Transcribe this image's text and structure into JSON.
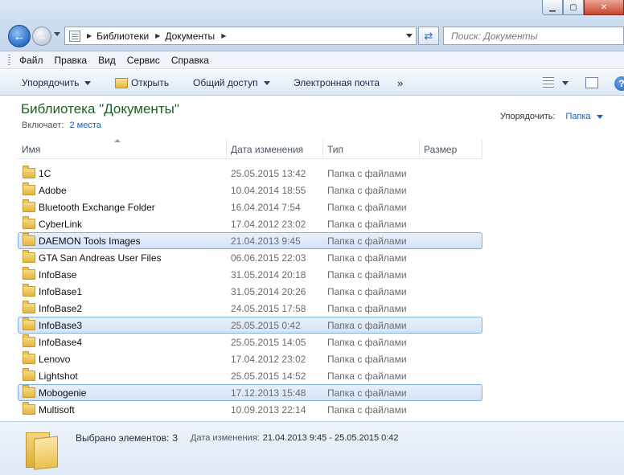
{
  "window": {
    "minimize_icon": "minimize-icon",
    "maximize_icon": "maximize-icon",
    "close_icon": "close-icon"
  },
  "address_bar": {
    "breadcrumbs": [
      "Библиотеки",
      "Документы"
    ],
    "search_placeholder": "Поиск: Документы"
  },
  "menu": [
    "Файл",
    "Правка",
    "Вид",
    "Сервис",
    "Справка"
  ],
  "toolbar": {
    "organize": "Упорядочить",
    "open": "Открыть",
    "share": "Общий доступ",
    "email": "Электронная почта",
    "more": "»",
    "help": "?"
  },
  "library": {
    "title": "Библиотека \"Документы\"",
    "includes_label": "Включает:",
    "includes_link": "2 места",
    "arrange_label": "Упорядочить:",
    "arrange_value": "Папка"
  },
  "columns": [
    "Имя",
    "Дата изменения",
    "Тип",
    "Размер"
  ],
  "files": [
    {
      "name": "1C",
      "date": "25.05.2015 13:42",
      "type": "Папка с файлами",
      "selected": false
    },
    {
      "name": "Adobe",
      "date": "10.04.2014 18:55",
      "type": "Папка с файлами",
      "selected": false
    },
    {
      "name": "Bluetooth Exchange Folder",
      "date": "16.04.2014 7:54",
      "type": "Папка с файлами",
      "selected": false
    },
    {
      "name": "CyberLink",
      "date": "17.04.2012 23:02",
      "type": "Папка с файлами",
      "selected": false
    },
    {
      "name": "DAEMON Tools Images",
      "date": "21.04.2013 9:45",
      "type": "Папка с файлами",
      "selected": true
    },
    {
      "name": "GTA San Andreas User Files",
      "date": "06.06.2015 22:03",
      "type": "Папка с файлами",
      "selected": false
    },
    {
      "name": "InfoBase",
      "date": "31.05.2014 20:18",
      "type": "Папка с файлами",
      "selected": false
    },
    {
      "name": "InfoBase1",
      "date": "31.05.2014 20:26",
      "type": "Папка с файлами",
      "selected": false
    },
    {
      "name": "InfoBase2",
      "date": "24.05.2015 17:58",
      "type": "Папка с файлами",
      "selected": false
    },
    {
      "name": "InfoBase3",
      "date": "25.05.2015 0:42",
      "type": "Папка с файлами",
      "selected": true
    },
    {
      "name": "InfoBase4",
      "date": "25.05.2015 14:05",
      "type": "Папка с файлами",
      "selected": false
    },
    {
      "name": "Lenovo",
      "date": "17.04.2012 23:02",
      "type": "Папка с файлами",
      "selected": false
    },
    {
      "name": "Lightshot",
      "date": "25.05.2015 14:52",
      "type": "Папка с файлами",
      "selected": false
    },
    {
      "name": "Mobogenie",
      "date": "17.12.2013 15:48",
      "type": "Папка с файлами",
      "selected": true
    },
    {
      "name": "Multisoft",
      "date": "10.09.2013 22:14",
      "type": "Папка с файлами",
      "selected": false
    }
  ],
  "details": {
    "selected_label": "Выбрано элементов:",
    "selected_count": "3",
    "date_label": "Дата изменения:",
    "date_range": "21.04.2013 9:45 - 25.05.2015 0:42"
  }
}
